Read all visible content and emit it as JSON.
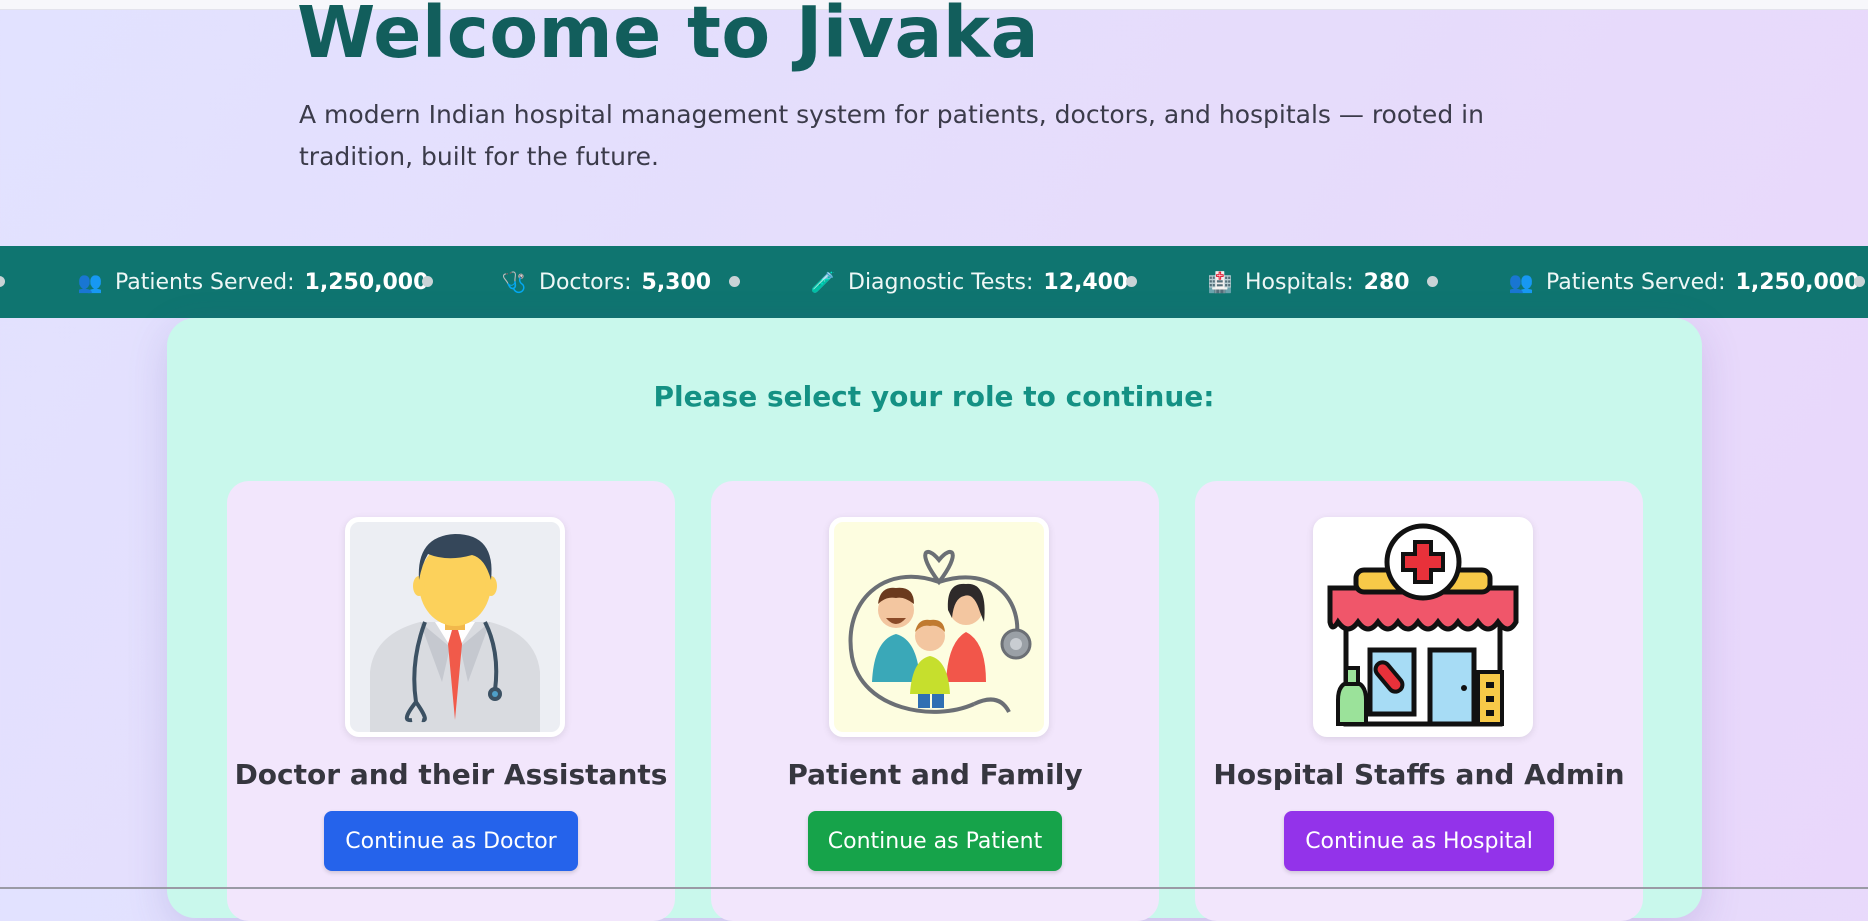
{
  "hero": {
    "title": "Welcome to Jivaka",
    "subtitle": "A modern Indian hospital management system for patients, doctors, and hospitals — rooted in tradition, built for the future."
  },
  "stats": [
    {
      "icon": "people-icon",
      "glyph": "👥",
      "label": "Patients Served:",
      "value": "1,250,000"
    },
    {
      "icon": "stethoscope-icon",
      "glyph": "🩺",
      "label": "Doctors:",
      "value": "5,300"
    },
    {
      "icon": "test-tube-icon",
      "glyph": "🧪",
      "label": "Diagnostic Tests:",
      "value": "12,400"
    },
    {
      "icon": "hospital-icon",
      "glyph": "🏥",
      "label": "Hospitals:",
      "value": "280"
    },
    {
      "icon": "people-icon",
      "glyph": "👥",
      "label": "Patients Served:",
      "value": "1,250,000"
    }
  ],
  "role_selection": {
    "heading": "Please select your role to continue:",
    "cards": [
      {
        "title": "Doctor and their Assistants",
        "button": "Continue as Doctor",
        "button_color": "#2563eb",
        "icon": "doctor-illustration-icon"
      },
      {
        "title": "Patient and Family",
        "button": "Continue as Patient",
        "button_color": "#16a34a",
        "icon": "family-illustration-icon"
      },
      {
        "title": "Hospital Staffs and Admin",
        "button": "Continue as Hospital",
        "button_color": "#9333ea",
        "icon": "hospital-building-icon"
      }
    ]
  },
  "colors": {
    "ticker_bg": "#0f7570",
    "panel_bg": "#c9f8ec",
    "card_bg": "#f2e6fc",
    "title": "#125e5c",
    "heading": "#149184"
  }
}
